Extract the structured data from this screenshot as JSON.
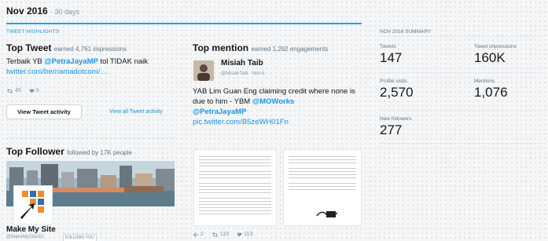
{
  "period": {
    "label": "Nov 2016",
    "days": "· 30 days"
  },
  "highlights_header": "TWEET HIGHLIGHTS",
  "top_tweet": {
    "title": "Top Tweet",
    "subtitle": "earned 4,761 impressions",
    "text_prefix": "Terbaik YB ",
    "mention": "@PetraJayaMP",
    "text_suffix": " tol TIDAK naik",
    "link": "twitter.com/bernamadotcom/…",
    "retweets": "46",
    "likes": "9",
    "button_label": "View Tweet activity",
    "all_link": "View all Tweet activity"
  },
  "top_mention": {
    "title": "Top mention",
    "subtitle": "earned 1,292 engagements",
    "name": "Misiah Taib",
    "handle": "@MisiahTaib · Nov 6",
    "text": "YAB Lim Guan Eng claiming credit where none is due to him - YBM ",
    "mention1": "@MOWorks",
    "mention2": "@PetraJayaMP",
    "link": "pic.twitter.com/B5zeWH01Fn",
    "replies": "2",
    "retweets": "118",
    "likes": "113"
  },
  "top_follower": {
    "title": "Top Follower",
    "subtitle": "followed by 17K people",
    "name": "Make My Site",
    "handle": "@MakeMySiteSG",
    "badge": "FOLLOWS YOU"
  },
  "summary": {
    "header": "NOV 2016 SUMMARY",
    "tweets_label": "Tweets",
    "tweets_value": "147",
    "impressions_label": "Tweet impressions",
    "impressions_value": "160K",
    "visits_label": "Profile visits",
    "visits_value": "2,570",
    "mentions_label": "Mentions",
    "mentions_value": "1,076",
    "followers_label": "New followers",
    "followers_value": "277"
  },
  "colors": {
    "accent": "#1da1f2",
    "link": "#1b95e0",
    "muted": "#8899a6"
  },
  "icons": [
    "retweet-icon",
    "heart-icon",
    "reply-icon"
  ]
}
